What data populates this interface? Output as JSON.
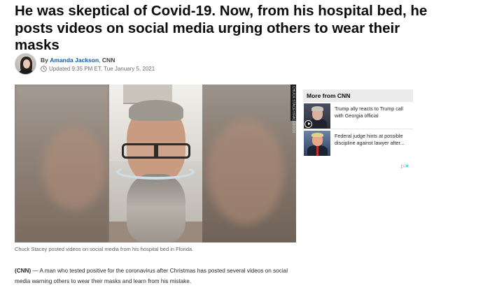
{
  "article": {
    "headline": "He was skeptical of Covid-19. Now, from his hospital bed, he posts videos on social media urging others to wear their masks",
    "byline": {
      "by_label": "By",
      "author": "Amanda Jackson",
      "separator": ",",
      "org": "CNN",
      "updated": "Updated 9:35 PM ET, Tue January 5, 2021"
    },
    "media": {
      "credit": "CHUCK STACEY/FACEBOOK",
      "caption": "Chuck Stacey posted videos on social media from his hospital bed in Florida."
    },
    "body": {
      "source": "(CNN)",
      "dash": " — ",
      "text": "A man who tested positive for the coronavirus after Christmas has posted several videos on social media warning others to wear their masks and learn from his mistake."
    }
  },
  "sidebar": {
    "more_title": "More from CNN",
    "items": [
      {
        "text": "Trump ally reacts to Trump call with Georgia official",
        "icon": "play-icon"
      },
      {
        "text": "Federal judge hints at possible discipline against lawyer after..."
      }
    ],
    "ad_badge": "▷✕"
  },
  "colors": {
    "author_link": "#0c5da5",
    "ad_choices": "#00aecd",
    "sidebar_header_bg": "#ebebeb"
  }
}
